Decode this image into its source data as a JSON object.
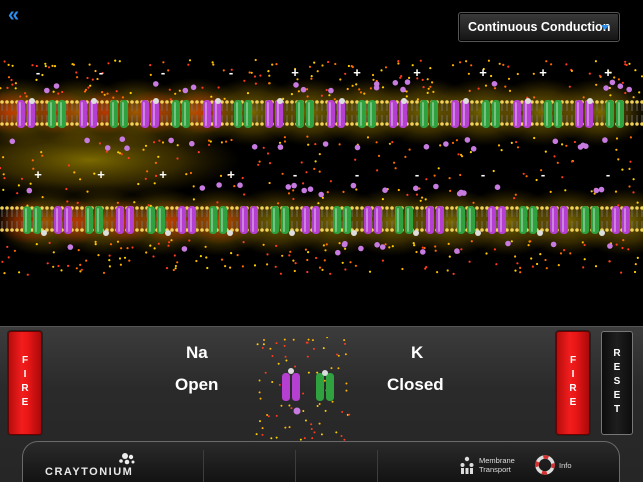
{
  "header": {
    "back_icon": "double-chevron-left-icon",
    "mode_select": {
      "selected": "Continuous Conduction",
      "caret_icon": "chevron-down-icon"
    }
  },
  "membrane": {
    "upper_charges": [
      "-",
      "-",
      "-",
      "-",
      "+",
      "+",
      "+",
      "+",
      "+",
      "+"
    ],
    "lower_charges": [
      "+",
      "+",
      "+",
      "+",
      "-",
      "-",
      "-",
      "-",
      "-",
      "-"
    ]
  },
  "controls": {
    "fire_left": "FIRE",
    "fire_right": "FIRE",
    "reset": "RESET",
    "na": {
      "name": "Na",
      "state": "Open"
    },
    "k": {
      "name": "K",
      "state": "Closed"
    }
  },
  "toolbar": {
    "brand": "CRAYTONIUM",
    "membrane_transport": "Membrane Transport",
    "info": "Info"
  },
  "colors": {
    "na_channel": "#b43fd0",
    "k_channel": "#2fa13f",
    "fire": "#ee1c1c",
    "accent": "#2b8ff0"
  }
}
